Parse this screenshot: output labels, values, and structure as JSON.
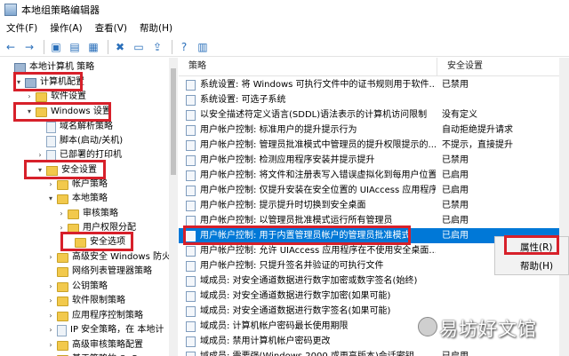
{
  "window": {
    "title": "本地组策略编辑器"
  },
  "menu": [
    "文件(F)",
    "操作(A)",
    "查看(V)",
    "帮助(H)"
  ],
  "toolbar": [
    {
      "icon": "back-arrow-icon",
      "glyph": "←"
    },
    {
      "icon": "forward-arrow-icon",
      "glyph": "→"
    },
    {
      "sep": true
    },
    {
      "icon": "up-folder-icon",
      "glyph": "▣"
    },
    {
      "icon": "show-tree-icon",
      "glyph": "▤"
    },
    {
      "icon": "list-icon",
      "glyph": "▦"
    },
    {
      "sep": true
    },
    {
      "icon": "delete-icon",
      "glyph": "✖"
    },
    {
      "icon": "properties-icon",
      "glyph": "▭"
    },
    {
      "icon": "export-icon",
      "glyph": "⇪"
    },
    {
      "sep": true
    },
    {
      "icon": "help-icon",
      "glyph": "?"
    },
    {
      "icon": "view-icon",
      "glyph": "▥"
    }
  ],
  "tree": [
    {
      "label": "本地计算机 策略",
      "icon": "pc"
    },
    {
      "label": "计算机配置",
      "icon": "pc",
      "exp": "▾"
    },
    {
      "label": "软件设置",
      "icon": "folder",
      "exp": "›"
    },
    {
      "label": "Windows 设置",
      "icon": "folder",
      "exp": "▾"
    },
    {
      "label": "域名解析策略",
      "icon": "doc"
    },
    {
      "label": "脚本(启动/关机)",
      "icon": "doc"
    },
    {
      "label": "已部署的打印机",
      "icon": "doc",
      "exp": "›"
    },
    {
      "label": "安全设置",
      "icon": "lock",
      "exp": "▾"
    },
    {
      "label": "帐户策略",
      "icon": "folder",
      "exp": "›"
    },
    {
      "label": "本地策略",
      "icon": "folder",
      "exp": "▾"
    },
    {
      "label": "审核策略",
      "icon": "folder",
      "exp": "›"
    },
    {
      "label": "用户权限分配",
      "icon": "folder",
      "exp": "›"
    },
    {
      "label": "安全选项",
      "icon": "folder"
    },
    {
      "label": "高级安全 Windows 防火",
      "icon": "folder",
      "exp": "›"
    },
    {
      "label": "网络列表管理器策略",
      "icon": "folder"
    },
    {
      "label": "公钥策略",
      "icon": "folder",
      "exp": "›"
    },
    {
      "label": "软件限制策略",
      "icon": "folder",
      "exp": "›"
    },
    {
      "label": "应用程序控制策略",
      "icon": "folder",
      "exp": "›"
    },
    {
      "label": "IP 安全策略，在 本地计",
      "icon": "doc",
      "exp": "›"
    },
    {
      "label": "高级审核策略配置",
      "icon": "folder",
      "exp": "›"
    },
    {
      "label": "基于策略的 QoS",
      "icon": "folder",
      "exp": "›"
    }
  ],
  "policies": {
    "col_policy": "策略",
    "col_setting": "安全设置",
    "rows": [
      {
        "name": "系统设置: 将 Windows 可执行文件中的证书规则用于软件...",
        "setting": "已禁用"
      },
      {
        "name": "系统设置: 可选子系统",
        "setting": ""
      },
      {
        "name": "以安全描述符定义语言(SDDL)语法表示的计算机访问限制",
        "setting": "没有定义"
      },
      {
        "name": "用户帐户控制: 标准用户的提升提示行为",
        "setting": "自动拒绝提升请求"
      },
      {
        "name": "用户帐户控制: 管理员批准模式中管理员的提升权限提示的...",
        "setting": "不提示，直接提升"
      },
      {
        "name": "用户帐户控制: 检测应用程序安装并提示提升",
        "setting": "已禁用"
      },
      {
        "name": "用户帐户控制: 将文件和注册表写入错误虚拟化到每用户位置",
        "setting": "已启用"
      },
      {
        "name": "用户帐户控制: 仅提升安装在安全位置的 UIAccess 应用程序",
        "setting": "已启用"
      },
      {
        "name": "用户帐户控制: 提示提升时切换到安全桌面",
        "setting": "已禁用"
      },
      {
        "name": "用户帐户控制: 以管理员批准模式运行所有管理员",
        "setting": "已启用"
      },
      {
        "name": "用户帐户控制: 用于内置管理员帐户的管理员批准模式",
        "setting": "已启用"
      },
      {
        "name": "用户帐户控制: 允许 UIAccess 应用程序在不使用安全桌面...",
        "setting": ""
      },
      {
        "name": "用户帐户控制: 只提升签名并验证的可执行文件",
        "setting": ""
      },
      {
        "name": "域成员: 对安全通道数据进行数字加密或数字签名(始终)",
        "setting": ""
      },
      {
        "name": "域成员: 对安全通道数据进行数字加密(如果可能)",
        "setting": ""
      },
      {
        "name": "域成员: 对安全通道数据进行数字签名(如果可能)",
        "setting": ""
      },
      {
        "name": "域成员: 计算机帐户密码最长使用期限",
        "setting": ""
      },
      {
        "name": "域成员: 禁用计算机帐户密码更改",
        "setting": ""
      },
      {
        "name": "域成员: 需要强(Windows 2000 或更高版本)会话密钥",
        "setting": "已启用"
      }
    ]
  },
  "context_menu": {
    "properties": "属性(R)",
    "help": "帮助(H)"
  },
  "watermark": "易坊好文馆"
}
